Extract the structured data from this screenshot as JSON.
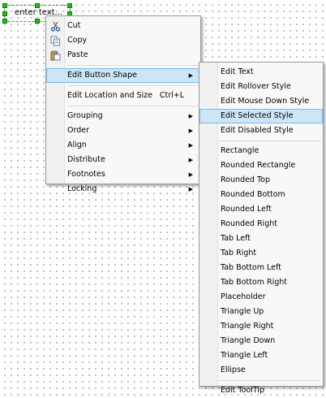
{
  "element": {
    "text": "enter text..."
  },
  "context_menu": {
    "items": [
      {
        "label": "Cut",
        "icon": "scissors-icon"
      },
      {
        "label": "Copy",
        "icon": "copy-icon"
      },
      {
        "label": "Paste",
        "icon": "paste-icon"
      },
      {
        "label": "Edit Button Shape",
        "arrow": "▶"
      },
      {
        "label": "Edit Location and Size",
        "shortcut": "Ctrl+L"
      },
      {
        "label": "Grouping",
        "arrow": "▶"
      },
      {
        "label": "Order",
        "arrow": "▶"
      },
      {
        "label": "Align",
        "arrow": "▶"
      },
      {
        "label": "Distribute",
        "arrow": "▶"
      },
      {
        "label": "Footnotes",
        "arrow": "▶"
      },
      {
        "label": "Locking",
        "arrow": "▶"
      }
    ]
  },
  "submenu": {
    "items": [
      "Edit Text",
      "Edit Rollover Style",
      "Edit Mouse Down Style",
      "Edit Selected Style",
      "Edit Disabled Style",
      "Rectangle",
      "Rounded Rectangle",
      "Rounded Top",
      "Rounded Bottom",
      "Rounded Left",
      "Rounded Right",
      "Tab Left",
      "Tab Right",
      "Tab Bottom Left",
      "Tab Bottom Right",
      "Placeholder",
      "Triangle Up",
      "Triangle Right",
      "Triangle Down",
      "Triangle Left",
      "Ellipse",
      "Edit ToolTip"
    ]
  }
}
